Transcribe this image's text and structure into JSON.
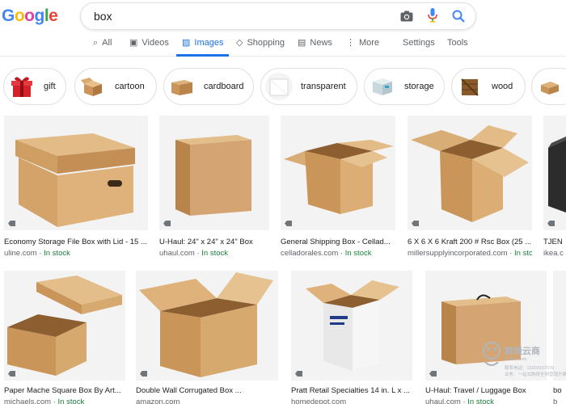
{
  "logo": "Google",
  "search": {
    "query": "box"
  },
  "tabs": [
    {
      "label": "All",
      "icon": "search-icon"
    },
    {
      "label": "Videos",
      "icon": "video-icon"
    },
    {
      "label": "Images",
      "icon": "image-icon"
    },
    {
      "label": "Shopping",
      "icon": "tag-icon"
    },
    {
      "label": "News",
      "icon": "news-icon"
    },
    {
      "label": "More",
      "icon": "more-vert-icon"
    }
  ],
  "settings_label": "Settings",
  "tools_label": "Tools",
  "chips": [
    {
      "label": "gift"
    },
    {
      "label": "cartoon"
    },
    {
      "label": "cardboard"
    },
    {
      "label": "transparent"
    },
    {
      "label": "storage"
    },
    {
      "label": "wood"
    },
    {
      "label": ""
    }
  ],
  "results": [
    {
      "title": "Economy Storage File Box with Lid - 15 ...",
      "source": "uline.com",
      "stock": "In stock"
    },
    {
      "title": "U-Haul: 24\" x 24\" x 24\" Box",
      "source": "uhaul.com",
      "stock": "In stock"
    },
    {
      "title": "General Shipping Box - Cellad...",
      "source": "celladorales.com",
      "stock": "In stock"
    },
    {
      "title": "6 X 6 X 6 Kraft 200 # Rsc Box (25 ...",
      "source": "millersupplyincorporated.com",
      "stock": "In stock"
    },
    {
      "title": "TJEN",
      "source": "ikea.c",
      "stock": ""
    },
    {
      "title": "Paper Mache Square Box By Art...",
      "source": "michaels.com",
      "stock": "In stock"
    },
    {
      "title": "Double Wall Corrugated Box ...",
      "source": "amazon.com",
      "stock": ""
    },
    {
      "title": "Pratt Retail Specialties 14 in. L x ...",
      "source": "homedepot.com",
      "stock": ""
    },
    {
      "title": "U-Haul: Travel / Luggage Box",
      "source": "uhaul.com",
      "stock": "In stock"
    },
    {
      "title": "bo",
      "source": "b",
      "stock": ""
    }
  ],
  "stock_separator": " · ",
  "watermark": {
    "title": "跨境云商",
    "line1": "联系电话：13203157078",
    "line2": "业务：一站式跨境全网营销方案",
    "site": "Vchoo.com"
  },
  "colors": {
    "accent": "#1a73e8",
    "stock": "#188038",
    "box": "#d4a573"
  }
}
